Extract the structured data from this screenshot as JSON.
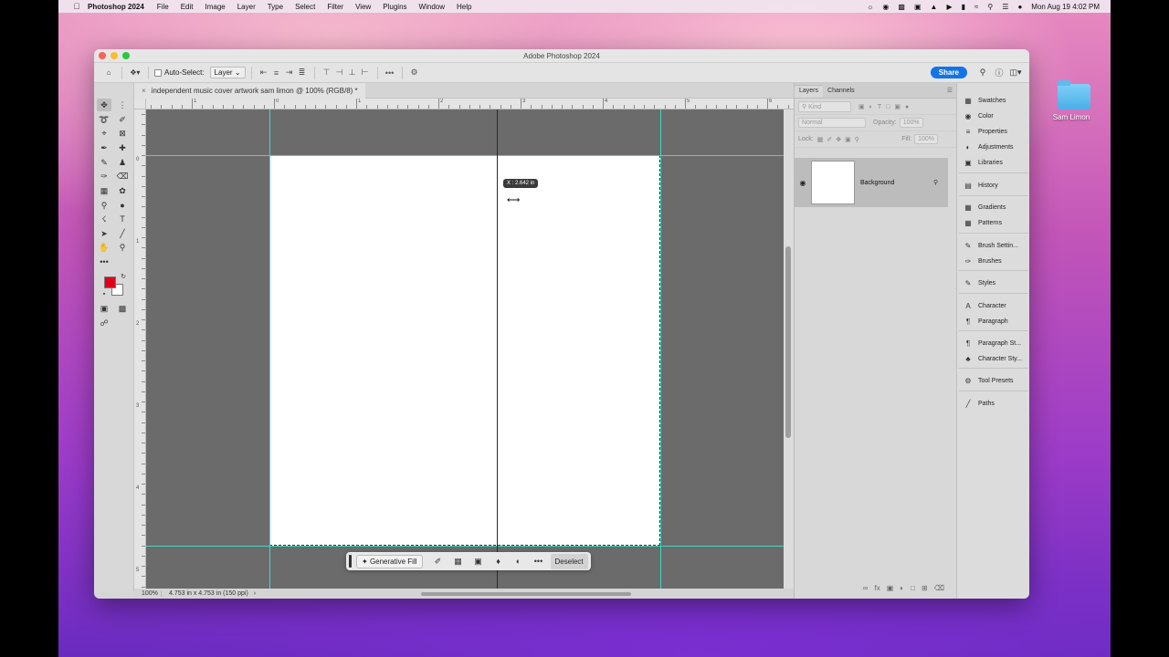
{
  "menubar": {
    "app_name": "Photoshop 2024",
    "items": [
      "File",
      "Edit",
      "Image",
      "Layer",
      "Type",
      "Select",
      "Filter",
      "View",
      "Plugins",
      "Window",
      "Help"
    ],
    "datetime": "Mon Aug 19  4:02 PM"
  },
  "desktop": {
    "folder_label": "Sam Limon"
  },
  "window": {
    "title": "Adobe Photoshop 2024"
  },
  "options_bar": {
    "auto_select_label": "Auto-Select:",
    "auto_select_target": "Layer",
    "share_label": "Share"
  },
  "document": {
    "tab_title": "independent music cover artwork sam limon @ 100% (RGB/8) *",
    "zoom": "100%",
    "doc_info": "4.753 in x 4.753 in (150 ppi)"
  },
  "rulers": {
    "top_labels": [
      "1",
      "0",
      "1",
      "2",
      "3",
      "4",
      "5",
      "6"
    ],
    "left_labels": [
      "0",
      "1",
      "2",
      "3",
      "4",
      "5"
    ]
  },
  "guide_readout": "X : 2.642 in",
  "task_bar": {
    "generative_fill": "Generative Fill",
    "deselect": "Deselect"
  },
  "layers_panel": {
    "tabs": [
      "Layers",
      "Channels"
    ],
    "kind_placeholder": "Kind",
    "blend_mode": "Normal",
    "opacity_label": "Opacity:",
    "opacity_value": "100%",
    "lock_label": "Lock:",
    "fill_label": "Fill:",
    "fill_value": "100%",
    "layer_name": "Background"
  },
  "dock": {
    "items": [
      "Swatches",
      "Color",
      "Properties",
      "Adjustments",
      "Libraries",
      "History",
      "Gradients",
      "Patterns",
      "Brush Settin...",
      "Brushes",
      "Styles",
      "Character",
      "Paragraph",
      "Paragraph St...",
      "Character Sty...",
      "Tool Presets",
      "Paths"
    ]
  },
  "colors": {
    "foreground": "#e0001b",
    "background": "#ffffff",
    "guide": "#3fd9c3",
    "accent": "#1473e6"
  }
}
